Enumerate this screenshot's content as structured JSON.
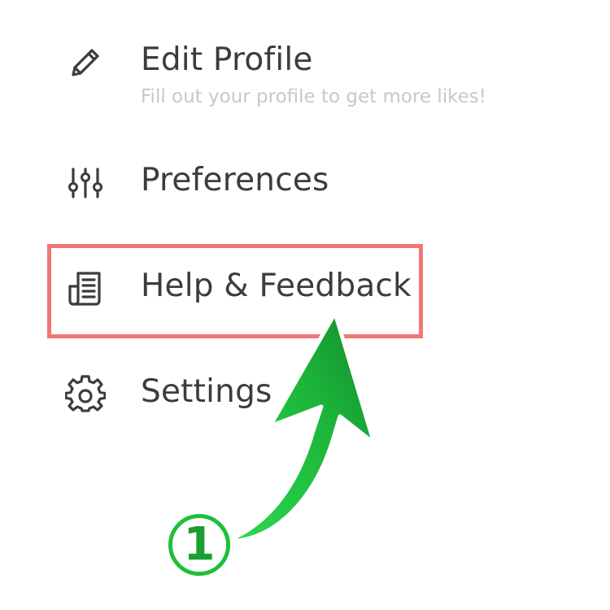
{
  "menu": {
    "items": [
      {
        "label": "Edit Profile",
        "subtitle": "Fill out your profile to get more likes!",
        "icon": "pencil-icon"
      },
      {
        "label": "Preferences",
        "icon": "sliders-icon"
      },
      {
        "label": "Help & Feedback",
        "icon": "document-icon"
      },
      {
        "label": "Settings",
        "icon": "gear-icon"
      }
    ]
  },
  "annotation": {
    "step_number": "1",
    "highlight_color": "#f07873",
    "arrow_color": "#1fbf3c",
    "badge_color": "#1a9e30"
  },
  "colors": {
    "label": "#3c3c3c",
    "subtitle": "#c8c8c8",
    "icon": "#3c3c3c",
    "background": "#ffffff"
  }
}
